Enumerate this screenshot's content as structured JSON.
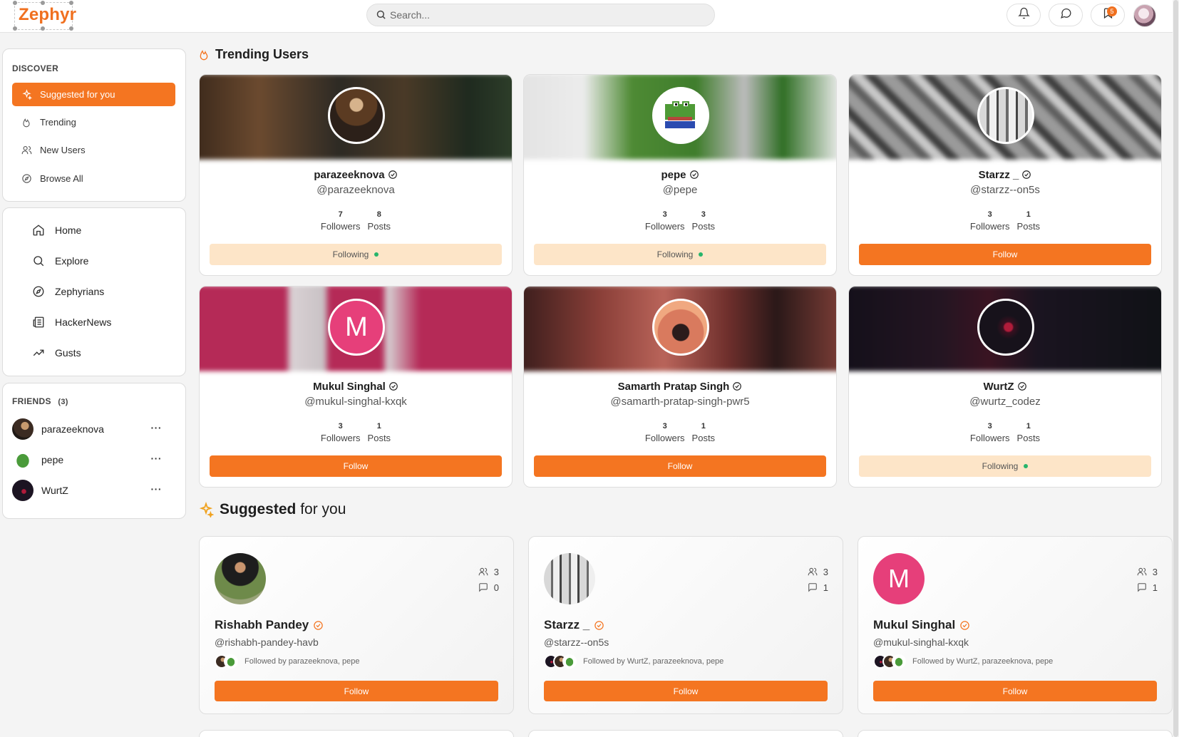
{
  "app": {
    "logo": "Zephyr"
  },
  "search": {
    "placeholder": "Search..."
  },
  "topbar": {
    "notifications_count": "5",
    "icons": [
      "bell-icon",
      "message-icon",
      "bookmark-icon"
    ]
  },
  "colors": {
    "accent": "#f47521",
    "following_bg": "#fde5c8",
    "online": "#27b56b"
  },
  "discover": {
    "title": "DISCOVER",
    "items": [
      {
        "label": "Suggested for you",
        "icon": "sparkle-icon",
        "active": true
      },
      {
        "label": "Trending",
        "icon": "flame-icon"
      },
      {
        "label": "New Users",
        "icon": "users-icon"
      },
      {
        "label": "Browse All",
        "icon": "compass-icon"
      }
    ]
  },
  "nav": {
    "items": [
      {
        "label": "Home",
        "icon": "home-icon"
      },
      {
        "label": "Explore",
        "icon": "search-icon"
      },
      {
        "label": "Zephyrians",
        "icon": "compass-icon"
      },
      {
        "label": "HackerNews",
        "icon": "newspaper-icon"
      },
      {
        "label": "Gusts",
        "icon": "trending-icon"
      }
    ]
  },
  "friends": {
    "title": "FRIENDS",
    "count": "(3)",
    "items": [
      {
        "name": "parazeeknova",
        "more": "···"
      },
      {
        "name": "pepe",
        "more": "···"
      },
      {
        "name": "WurtZ",
        "more": "···"
      }
    ]
  },
  "trending": {
    "title": "Trending Users",
    "users": [
      {
        "name": "parazeeknova",
        "handle": "@parazeeknova",
        "followers": "7",
        "followers_label": "Followers",
        "posts": "8",
        "posts_label": "Posts",
        "button": "Following",
        "following": true
      },
      {
        "name": "pepe",
        "handle": "@pepe",
        "followers": "3",
        "followers_label": "Followers",
        "posts": "3",
        "posts_label": "Posts",
        "button": "Following",
        "following": true
      },
      {
        "name": "Starzz _",
        "handle": "@starzz--on5s",
        "followers": "3",
        "followers_label": "Followers",
        "posts": "1",
        "posts_label": "Posts",
        "button": "Follow",
        "following": false
      },
      {
        "name": "Mukul Singhal",
        "handle": "@mukul-singhal-kxqk",
        "avatar_letter": "M",
        "followers": "3",
        "followers_label": "Followers",
        "posts": "1",
        "posts_label": "Posts",
        "button": "Follow",
        "following": false
      },
      {
        "name": "Samarth Pratap Singh",
        "handle": "@samarth-pratap-singh-pwr5",
        "followers": "3",
        "followers_label": "Followers",
        "posts": "1",
        "posts_label": "Posts",
        "button": "Follow",
        "following": false
      },
      {
        "name": "WurtZ",
        "handle": "@wurtz_codez",
        "followers": "3",
        "followers_label": "Followers",
        "posts": "1",
        "posts_label": "Posts",
        "button": "Following",
        "following": true
      }
    ]
  },
  "suggested": {
    "title_a": "Suggested",
    "title_b": "for you",
    "users": [
      {
        "name": "Rishabh Pandey",
        "handle": "@rishabh-pandey-havb",
        "followers": "3",
        "posts": "0",
        "followed_by": "Followed by parazeeknova, pepe",
        "button": "Follow"
      },
      {
        "name": "Starzz _",
        "handle": "@starzz--on5s",
        "followers": "3",
        "posts": "1",
        "followed_by": "Followed by WurtZ, parazeeknova, pepe",
        "button": "Follow"
      },
      {
        "name": "Mukul Singhal",
        "handle": "@mukul-singhal-kxqk",
        "avatar_letter": "M",
        "followers": "3",
        "posts": "1",
        "followed_by": "Followed by WurtZ, parazeeknova, pepe",
        "button": "Follow"
      }
    ]
  }
}
